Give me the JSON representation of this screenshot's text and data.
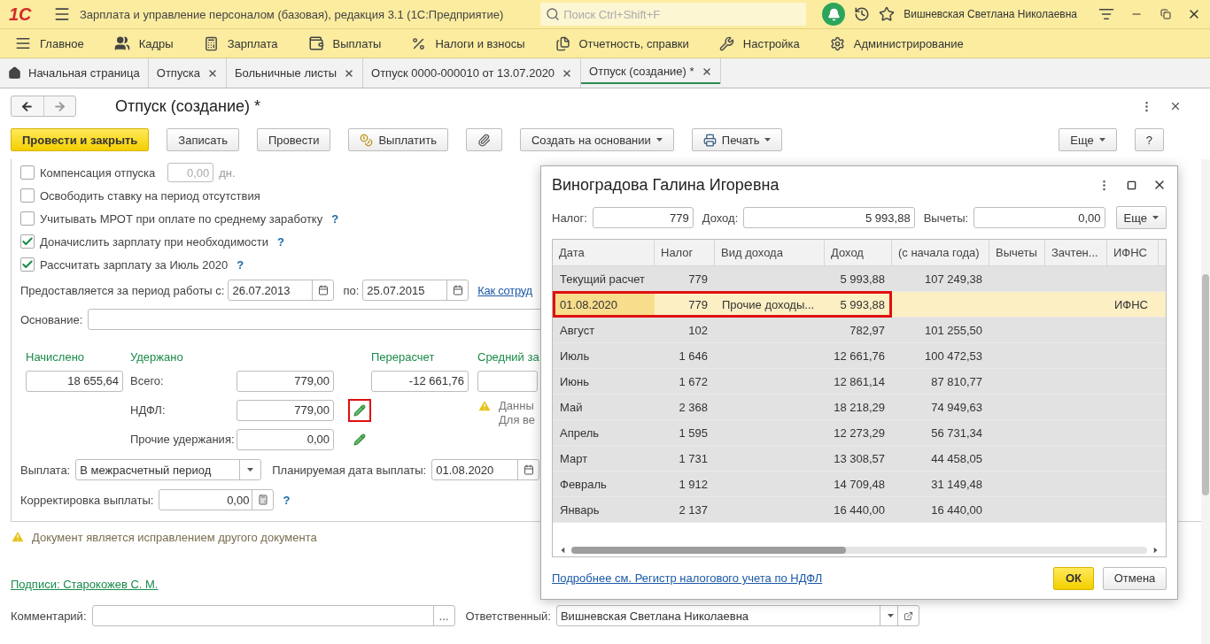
{
  "app": {
    "logo": "1С",
    "title": "Зарплата и управление персоналом (базовая), редакция 3.1  (1С:Предприятие)",
    "search_placeholder": "Поиск Ctrl+Shift+F",
    "user": "Вишневская Светлана Николаевна"
  },
  "sections": [
    {
      "label": "Главное"
    },
    {
      "label": "Кадры"
    },
    {
      "label": "Зарплата"
    },
    {
      "label": "Выплаты"
    },
    {
      "label": "Налоги и взносы"
    },
    {
      "label": "Отчетность, справки"
    },
    {
      "label": "Настройка"
    },
    {
      "label": "Администрирование"
    }
  ],
  "tabs": [
    {
      "label": "Начальная страница",
      "selected": false,
      "kind": "home"
    },
    {
      "label": "Отпуска",
      "selected": false,
      "kind": "closable"
    },
    {
      "label": "Больничные листы",
      "selected": false,
      "kind": "closable"
    },
    {
      "label": "Отпуск 0000-000010 от 13.07.2020",
      "selected": false,
      "kind": "closable"
    },
    {
      "label": "Отпуск (создание) *",
      "selected": true,
      "kind": "closable"
    }
  ],
  "document": {
    "title": "Отпуск (создание) *"
  },
  "toolbar": [
    {
      "label": "Провести и закрыть",
      "primary": true,
      "dropdown": false
    },
    {
      "label": "Записать",
      "primary": false,
      "dropdown": false
    },
    {
      "label": "Провести",
      "primary": false,
      "dropdown": false
    },
    {
      "label": "Выплатить",
      "primary": false,
      "dropdown": false
    },
    {
      "primary": false,
      "dropdown": false
    },
    {
      "label": "Создать на основании",
      "primary": false,
      "dropdown": true
    },
    {
      "label": "Печать",
      "primary": false,
      "dropdown": true
    }
  ],
  "toolbar_right": [
    {
      "label": "Еще",
      "primary": false,
      "dropdown": true
    },
    {
      "label": "?",
      "primary": false,
      "dropdown": false
    }
  ],
  "options": [
    {
      "label": "Компенсация отпуска",
      "checked": false,
      "days": "0,00",
      "unit": "дн."
    },
    {
      "label": "Освободить ставку на период отсутствия",
      "checked": false
    },
    {
      "label": "Учитывать МРОТ при оплате по среднему заработку",
      "checked": false,
      "help": "?"
    },
    {
      "label": "Доначислить зарплату при необходимости",
      "checked": true,
      "help": "?"
    },
    {
      "label": "Рассчитать зарплату за Июль 2020",
      "checked": true,
      "help": "?"
    }
  ],
  "period": {
    "label": "Предоставляется за период работы с:",
    "from": "26.07.2013",
    "to_label": "по:",
    "to": "25.07.2015",
    "link": "Как сотруд"
  },
  "basis": {
    "label": "Основание:"
  },
  "totals": {
    "accrued": {
      "heading": "Начислено",
      "value": "18 655,64"
    },
    "withheld": {
      "heading": "Удержано",
      "rows": [
        {
          "label": "Всего:",
          "value": "779,00",
          "edit": false
        },
        {
          "label": "НДФЛ:",
          "value": "779,00",
          "edit": true,
          "highlight": true
        },
        {
          "label": "Прочие удержания:",
          "value": "0,00",
          "edit": true,
          "highlight": false
        }
      ]
    },
    "recalc": {
      "heading": "Перерасчет",
      "value": "-12 661,76"
    },
    "average": {
      "heading": "Средний за"
    },
    "notice": [
      "Данны",
      "Для ве"
    ]
  },
  "payment": {
    "label": "Выплата:",
    "value": "В межрасчетный период",
    "date_label": "Планируемая дата выплаты:",
    "date": "01.08.2020"
  },
  "correction": {
    "label": "Корректировка выплаты:",
    "value": "0,00",
    "help": "?"
  },
  "warning": "Документ является исправлением другого документа",
  "signatures": "Подписи: Старокожев С. М.",
  "comment": {
    "label": "Комментарий:",
    "button": "..."
  },
  "responsible": {
    "label": "Ответственный:",
    "value": "Вишневская Светлана Николаевна"
  },
  "dialog": {
    "title": "Виноградова Галина Игоревна",
    "summary": [
      {
        "label": "Налог:",
        "value": "779"
      },
      {
        "label": "Доход:",
        "value": "5 993,88"
      },
      {
        "label": "Вычеты:",
        "value": "0,00"
      }
    ],
    "more": "Еще",
    "columns": [
      {
        "label": "Дата",
        "kind": "text"
      },
      {
        "label": "Налог",
        "kind": "number"
      },
      {
        "label": "Вид дохода",
        "kind": "text"
      },
      {
        "label": "Доход",
        "kind": "number"
      },
      {
        "label": "(с начала года)",
        "kind": "number"
      },
      {
        "label": "Вычеты",
        "kind": "number"
      },
      {
        "label": "Зачтен...",
        "kind": "number"
      },
      {
        "label": "ИФНС",
        "kind": "text"
      }
    ],
    "rows": [
      {
        "cells": [
          "Текущий расчет",
          "779",
          null,
          "5 993,88",
          "107 249,38",
          null,
          null,
          null
        ],
        "selected": false,
        "highlight": false
      },
      {
        "cells": [
          "01.08.2020",
          "779",
          "Прочие доходы...",
          "5 993,88",
          null,
          null,
          null,
          "ИФНС"
        ],
        "selected": true,
        "highlight": true
      },
      {
        "cells": [
          "Август",
          "102",
          null,
          "782,97",
          "101 255,50",
          null,
          null,
          null
        ],
        "selected": false,
        "highlight": false
      },
      {
        "cells": [
          "Июль",
          "1 646",
          null,
          "12 661,76",
          "100 472,53",
          null,
          null,
          null
        ],
        "selected": false,
        "highlight": false
      },
      {
        "cells": [
          "Июнь",
          "1 672",
          null,
          "12 861,14",
          "87 810,77",
          null,
          null,
          null
        ],
        "selected": false,
        "highlight": false
      },
      {
        "cells": [
          "Май",
          "2 368",
          null,
          "18 218,29",
          "74 949,63",
          null,
          null,
          null
        ],
        "selected": false,
        "highlight": false
      },
      {
        "cells": [
          "Апрель",
          "1 595",
          null,
          "12 273,29",
          "56 731,34",
          null,
          null,
          null
        ],
        "selected": false,
        "highlight": false
      },
      {
        "cells": [
          "Март",
          "1 731",
          null,
          "13 308,57",
          "44 458,05",
          null,
          null,
          null
        ],
        "selected": false,
        "highlight": false
      },
      {
        "cells": [
          "Февраль",
          "1 912",
          null,
          "14 709,48",
          "31 149,48",
          null,
          null,
          null
        ],
        "selected": false,
        "highlight": false
      },
      {
        "cells": [
          "Январь",
          "2 137",
          null,
          "16 440,00",
          "16 440,00",
          null,
          null,
          null
        ],
        "selected": false,
        "highlight": false
      }
    ],
    "link": "Подробнее см. Регистр налогового учета по НДФЛ",
    "ok": "ОК",
    "cancel": "Отмена"
  }
}
